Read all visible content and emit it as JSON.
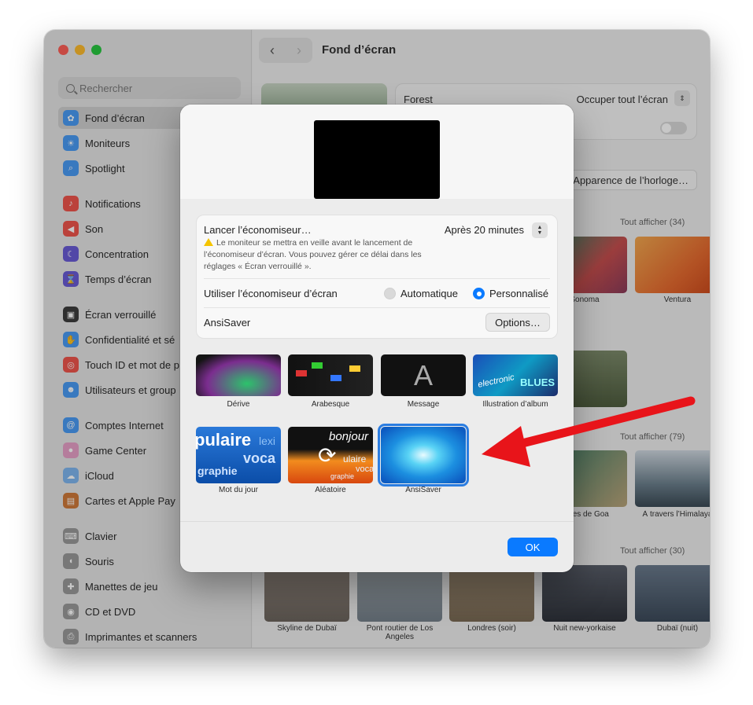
{
  "window": {
    "title": "Fond d’écran"
  },
  "sidebar": {
    "search_placeholder": "Rechercher",
    "items": [
      {
        "label": "Fond d’écran",
        "icon": "wallpaper-icon",
        "color": "#4a9cf5"
      },
      {
        "label": "Moniteurs",
        "icon": "display-icon",
        "color": "#4a9cf5"
      },
      {
        "label": "Spotlight",
        "icon": "spotlight-icon",
        "color": "#4a9cf5"
      },
      {
        "label": "Notifications",
        "icon": "bell-icon",
        "color": "#f0554c"
      },
      {
        "label": "Son",
        "icon": "speaker-icon",
        "color": "#f0554c"
      },
      {
        "label": "Concentration",
        "icon": "moon-icon",
        "color": "#6a5cd6"
      },
      {
        "label": "Temps d’écran",
        "icon": "hourglass-icon",
        "color": "#6a5cd6"
      },
      {
        "label": "Écran verrouillé",
        "icon": "lock-icon",
        "color": "#3d3d3d"
      },
      {
        "label": "Confidentialité et sé",
        "icon": "hand-icon",
        "color": "#4a9cf5"
      },
      {
        "label": "Touch ID et mot de p",
        "icon": "fingerprint-icon",
        "color": "#f0554c"
      },
      {
        "label": "Utilisateurs et group",
        "icon": "users-icon",
        "color": "#4a9cf5"
      },
      {
        "label": "Comptes Internet",
        "icon": "at-icon",
        "color": "#4a9cf5"
      },
      {
        "label": "Game Center",
        "icon": "gamecenter-icon",
        "color": "#e8a0c8"
      },
      {
        "label": "iCloud",
        "icon": "cloud-icon",
        "color": "#7fb7f0"
      },
      {
        "label": "Cartes et Apple Pay",
        "icon": "wallet-icon",
        "color": "#d07a3a"
      },
      {
        "label": "Clavier",
        "icon": "keyboard-icon",
        "color": "#9a9a9a"
      },
      {
        "label": "Souris",
        "icon": "mouse-icon",
        "color": "#9a9a9a"
      },
      {
        "label": "Manettes de jeu",
        "icon": "gamepad-icon",
        "color": "#9a9a9a"
      },
      {
        "label": "CD et DVD",
        "icon": "disc-icon",
        "color": "#9a9a9a"
      },
      {
        "label": "Imprimantes et scanners",
        "icon": "printer-icon",
        "color": "#9a9a9a"
      }
    ]
  },
  "content": {
    "panel": {
      "name": "Forest",
      "fill_mode": "Occuper tout l’écran"
    },
    "clock_button": "Apparence de l’horloge…",
    "see_all_1": "Tout afficher (34)",
    "see_all_2": "Tout afficher (79)",
    "see_all_3": "Tout afficher (30)",
    "thumbs_row1": [
      "Sonoma",
      "Ventura"
    ],
    "thumbs_row3": [
      "Côtes de Goa",
      "À travers l’Himalaya"
    ],
    "thumbs_row4": [
      "Skyline de Dubaï",
      "Pont routier de Los Angeles",
      "Londres (soir)",
      "Nuit new-yorkaise",
      "Dubaï (nuit)"
    ]
  },
  "sheet": {
    "start_label": "Lancer l’économiseur…",
    "start_value": "Après 20 minutes",
    "warning": "Le moniteur se mettra en veille avant le lancement de l’économiseur d’écran. Vous pouvez gérer ce délai dans les réglages « Écran verrouillé ».",
    "use_label": "Utiliser l’économiseur d’écran",
    "radio_auto": "Automatique",
    "radio_custom": "Personnalisé",
    "selected_saver": "AnsiSaver",
    "options_button": "Options…",
    "savers_row1": [
      "Dérive",
      "Arabesque",
      "Message",
      "Illustration d’album"
    ],
    "savers_row2": [
      "Mot du jour",
      "Aléatoire",
      "AnsiSaver"
    ],
    "message_glyph": "A",
    "word_tile": {
      "line1": "pulaire",
      "line2": "lexi",
      "line3": "voca",
      "line4": "graphie"
    },
    "random_tile": {
      "word1": "bonjour",
      "word2": "ulaire",
      "word3": "voca",
      "word4": "graphie"
    },
    "album_tile": {
      "word1": "electronic",
      "word2": "BLUES"
    },
    "ok_button": "OK"
  },
  "colors": {
    "accent": "#0a7aff",
    "arrow": "#e8141a"
  }
}
